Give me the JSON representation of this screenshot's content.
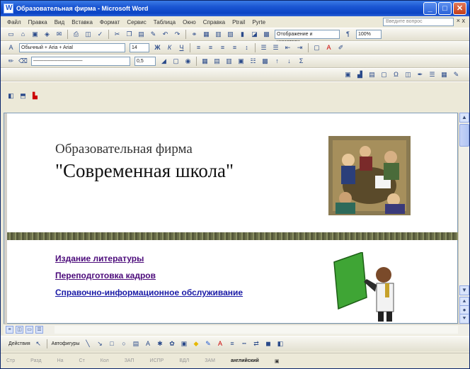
{
  "window": {
    "title": "Образовательная фирма - Microsoft Word",
    "btn_min": "_",
    "btn_max": "□",
    "btn_close": "✕"
  },
  "menu": {
    "items": [
      "Файл",
      "Правка",
      "Вид",
      "Вставка",
      "Формат",
      "Сервис",
      "Таблица",
      "Окно",
      "Справка",
      "Ptrail",
      "Pyrte"
    ],
    "help_placeholder": "Введите вопрос",
    "close": "× x"
  },
  "toolbar_std": {
    "zoom": "100%",
    "view_label": "Отображение и указатели..."
  },
  "toolbar_fmt": {
    "style": "Обычный + Aria + Arial",
    "size": "14"
  },
  "toolbar_draw_line": {
    "width": "0,5"
  },
  "document": {
    "title_line1": "Образовательная фирма",
    "title_line2": "\"Современная школа\"",
    "links": [
      "Издание литературы",
      "Переподготовка кадров",
      "Справочно-информационное обслуживание"
    ]
  },
  "drawbar": {
    "actions": "Действия",
    "autoshapes": "Автофигуры"
  },
  "statusbar": {
    "items": [
      "Стр",
      "Разд",
      "На",
      "Ст",
      "Кол",
      "ЗАП",
      "ИСПР",
      "ВДЛ",
      "ЗАМ"
    ],
    "language": "английский"
  },
  "colors": {
    "title_gradient": "#1a55d2",
    "link_color": "#4b0a7a",
    "band_color": "#6a6e4a"
  }
}
